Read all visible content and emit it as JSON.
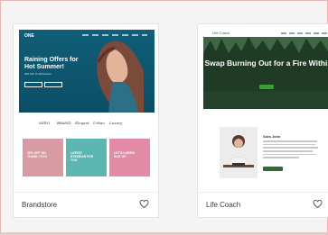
{
  "templates": [
    {
      "name": "Brandstore",
      "preview": {
        "logo": "ONE",
        "hero_title": "Raining Offers for Hot Summer!",
        "hero_sub": "25% OFF On All Products",
        "brands": [
          "MIRO",
          "BRAND",
          "Elegant",
          "Urban",
          "Luxury"
        ],
        "tiles": [
          "20% OFF ON THANK TOYS",
          "LATEST EYEWEAR FOR YOU",
          "LET'S LOREM SUIT UP"
        ]
      }
    },
    {
      "name": "Life Coach",
      "preview": {
        "logo": "Life Coach",
        "hero_title": "Swap Burning Out for a Fire Within",
        "bio_name": "Sara John"
      }
    }
  ],
  "colors": {
    "brand_hero": "#0f5e78",
    "coach_green": "#2f6b34",
    "frame_border": "#e5b7b7"
  },
  "icons": {
    "favorite": "heart-outline-icon"
  }
}
